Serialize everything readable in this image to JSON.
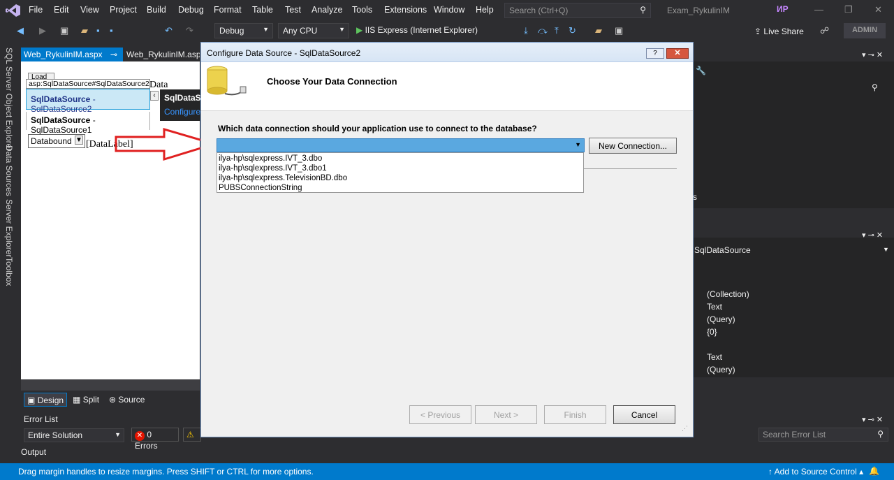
{
  "menubar": {
    "items": [
      "File",
      "Edit",
      "View",
      "Project",
      "Build",
      "Debug",
      "Format",
      "Table",
      "Test",
      "Analyze",
      "Tools",
      "Extensions",
      "Window",
      "Help"
    ],
    "search_placeholder": "Search (Ctrl+Q)",
    "solution_name": "Exam_RykulinIM",
    "avatar_initials": "ИР"
  },
  "toolbar": {
    "config": "Debug",
    "platform": "Any CPU",
    "run_label": "IIS Express (Internet Explorer)",
    "live_share": "Live Share",
    "admin": "ADMIN"
  },
  "left_tabs": [
    "SQL Server Object Explorer",
    "Data Sources",
    "Server Explorer",
    "Toolbox"
  ],
  "doc_tabs": {
    "active": "Web_RykulinIM.aspx",
    "other": "Web_RykulinIM.aspx.cs"
  },
  "designer": {
    "load_button": "Load",
    "smart_tag": "asp:SqlDataSource#SqlDataSource2",
    "data_text": "Data",
    "item_selected_strong": "SqlDataSource",
    "item_selected_rest": " - SqlDataSource2",
    "item_other_strong": "SqlDataSource",
    "item_other_rest": " - SqlDataSource1",
    "dropdown": "Databound",
    "datalabel": "[DataLabel]",
    "tasks_title": "SqlDataSource Tasks",
    "tasks_link": "Configure Data Source..."
  },
  "viewbar": {
    "design": "Design",
    "split": "Split",
    "source": "Source"
  },
  "error_list": {
    "title": "Error List",
    "scope": "Entire Solution",
    "errors": "0 Errors",
    "search_placeholder": "Search Error List"
  },
  "output_label": "Output",
  "properties": {
    "object": "SqlDataSource",
    "rows": [
      "(Collection)",
      "Text",
      "(Query)",
      "{0}",
      "Text",
      "(Query)"
    ],
    "stray_text": "s"
  },
  "dialog": {
    "title": "Configure Data Source - SqlDataSource2",
    "heading": "Choose Your Data Connection",
    "question": "Which data connection should your application use to connect to the database?",
    "connection_value": "",
    "connections": [
      "ilya-hp\\sqlexpress.IVT_3.dbo",
      "ilya-hp\\sqlexpress.IVT_3.dbo1",
      "ilya-hp\\sqlexpress.TelevisionBD.dbo",
      "PUBSConnectionString"
    ],
    "new_connection": "New Connection...",
    "previous": "< Previous",
    "next": "Next >",
    "finish": "Finish",
    "cancel": "Cancel",
    "help_glyph": "?",
    "close_glyph": "✕"
  },
  "statusbar": {
    "message": "Drag margin handles to resize margins. Press SHIFT or CTRL for more options.",
    "source_control": "Add to Source Control"
  },
  "colors": {
    "accent": "#007acc",
    "annotation_arrow": "#e02020",
    "combo_selected": "#5aa8e0"
  },
  "icons": [
    "visual-studio-logo-icon",
    "search-icon",
    "database-icon",
    "annotation-arrow-icon",
    "run-icon",
    "error-icon",
    "warning-icon",
    "notification-icon"
  ]
}
